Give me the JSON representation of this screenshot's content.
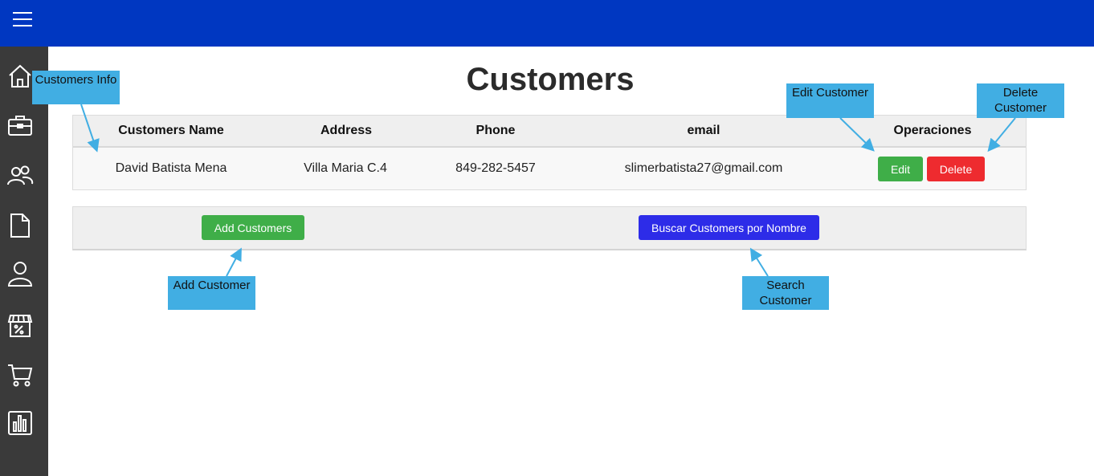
{
  "page": {
    "title": "Customers"
  },
  "topbar": {
    "menu_icon": "hamburger-menu-icon",
    "color": "#0037c1"
  },
  "sidebar": {
    "icons": [
      "home-icon",
      "briefcase-icon",
      "users-icon",
      "document-icon",
      "user-icon",
      "store-icon",
      "cart-icon",
      "bar-chart-icon"
    ]
  },
  "table": {
    "headers": [
      "Customers Name",
      "Address",
      "Phone",
      "email",
      "Operaciones"
    ],
    "rows": [
      {
        "name": "David Batista Mena",
        "address": "Villa Maria C.4",
        "phone": "849-282-5457",
        "email": "slimerbatista27@gmail.com",
        "edit_label": "Edit",
        "delete_label": "Delete"
      }
    ]
  },
  "actions": {
    "add_label": "Add Customers",
    "search_label": "Buscar Customers por Nombre"
  },
  "annotations": {
    "customers_info": "Customers Info",
    "edit_customer": "Edit Customer",
    "delete_customer": "Delete Customer",
    "add_customer": "Add Customer",
    "search_customer": "Search Customer"
  },
  "colors": {
    "green": "#3fae48",
    "red": "#ee2b2f",
    "blue": "#2d2ce8",
    "callout": "#41aee3",
    "sidebar": "#3a3a3a"
  }
}
